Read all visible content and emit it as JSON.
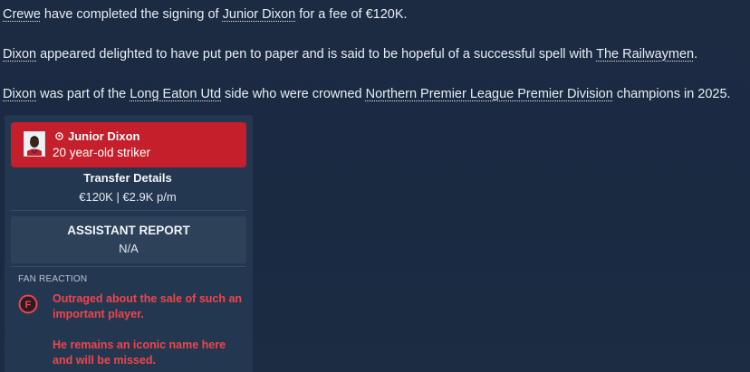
{
  "news": {
    "p1": {
      "club": "Crewe",
      "text_a": " have completed the signing of ",
      "player": "Junior Dixon",
      "text_b": " for a fee of €120K."
    },
    "p2": {
      "player": "Dixon",
      "text_a": " appeared delighted to have put pen to paper and is said to be hopeful of a successful spell with ",
      "club": "The Railwaymen",
      "text_b": "."
    },
    "p3": {
      "player": "Dixon",
      "text_a": " was part of the ",
      "club": "Long Eaton Utd",
      "text_b": " side who were crowned ",
      "competition": "Northern Premier League Premier Division",
      "text_c": " champions in 2025."
    }
  },
  "player_card": {
    "name": "Junior Dixon",
    "subtitle": "20 year-old striker",
    "card_color": "#c41f2b",
    "icons": [
      "avatar-icon",
      "person-icon"
    ]
  },
  "transfer": {
    "title": "Transfer Details",
    "value": "€120K | €2.9K p/m"
  },
  "assistant_report": {
    "title": "ASSISTANT REPORT",
    "value": "N/A"
  },
  "fan_reaction": {
    "title": "FAN REACTION",
    "icon": "fan-icon",
    "icon_letter": "F",
    "line1": "Outraged about the sale of such an important player.",
    "line2": "He remains an iconic name here and will be missed.",
    "color": "#f0454a"
  }
}
